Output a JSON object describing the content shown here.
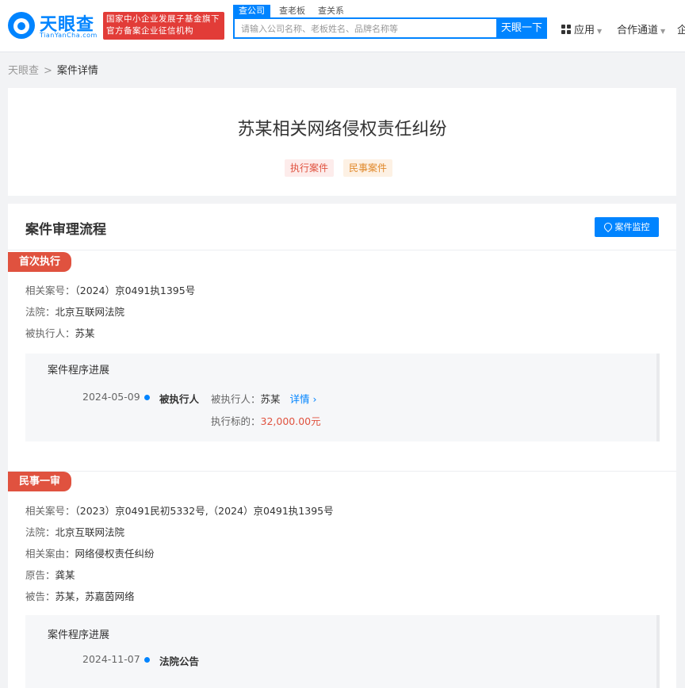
{
  "header": {
    "logo_name": "天眼查",
    "logo_sub": "TianYanCha.com",
    "badge_line1": "国家中小企业发展子基金旗下",
    "badge_line2": "官方备案企业征信机构",
    "tabs": [
      "查公司",
      "查老板",
      "查关系"
    ],
    "search_placeholder": "请输入公司名称、老板姓名、品牌名称等",
    "search_button": "天眼一下",
    "nav_apps": "应用",
    "nav_partner": "合作通道",
    "nav_more": "企"
  },
  "breadcrumb": {
    "home": "天眼查",
    "separator": ">",
    "current": "案件详情"
  },
  "case": {
    "title": "苏某相关网络侵权责任纠纷",
    "tags": [
      "执行案件",
      "民事案件"
    ]
  },
  "process": {
    "title": "案件审理流程",
    "monitor_button": "案件监控",
    "stages": [
      {
        "name": "首次执行",
        "fields": [
          {
            "label": "相关案号：",
            "value": "（2024）京0491执1395号"
          },
          {
            "label": "法院：",
            "value": "北京互联网法院"
          },
          {
            "label": "被执行人：",
            "value": "苏某"
          }
        ],
        "progress_title": "案件程序进展",
        "events": [
          {
            "date": "2024-05-09",
            "event": "被执行人",
            "detail_label": "被执行人：",
            "detail_value": "苏某",
            "link": "详情",
            "amount_label": "执行标的：",
            "amount_value": "32,000.00元"
          }
        ]
      },
      {
        "name": "民事一审",
        "fields": [
          {
            "label": "相关案号：",
            "value": "（2023）京0491民初5332号,（2024）京0491执1395号"
          },
          {
            "label": "法院：",
            "value": "北京互联网法院"
          },
          {
            "label": "相关案由：",
            "value": "网络侵权责任纠纷"
          },
          {
            "label": "原告：",
            "value": "龚某"
          },
          {
            "label": "被告：",
            "value": "苏某，苏嘉茵网络"
          }
        ],
        "progress_title": "案件程序进展",
        "events": [
          {
            "date": "2024-11-07",
            "event": "法院公告"
          }
        ]
      }
    ]
  },
  "colors": {
    "accent": "#0084ff",
    "stage_red": "#e0523f",
    "badge_red": "#e23c38"
  }
}
